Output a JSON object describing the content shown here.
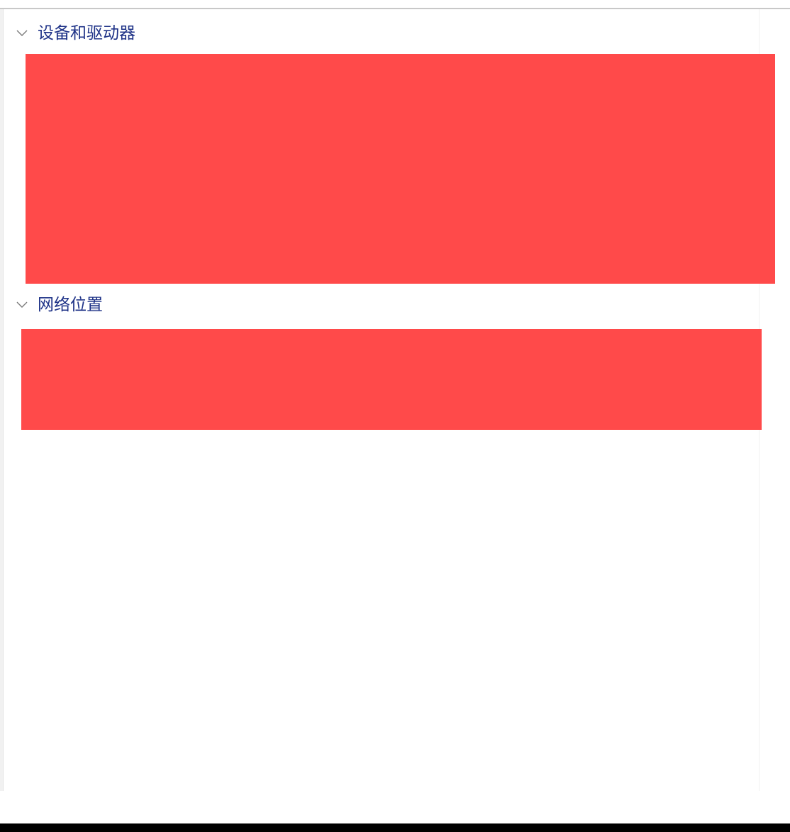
{
  "groups": {
    "devices": {
      "label": "设备和驱动器",
      "chevron_icon": "chevron-down-icon",
      "expanded": true
    },
    "network": {
      "label": "网络位置",
      "chevron_icon": "chevron-down-icon",
      "expanded": true
    }
  },
  "colors": {
    "group_label": "#1e3287",
    "redaction": "#ff4a4a",
    "chevron": "#7a7a7a"
  }
}
